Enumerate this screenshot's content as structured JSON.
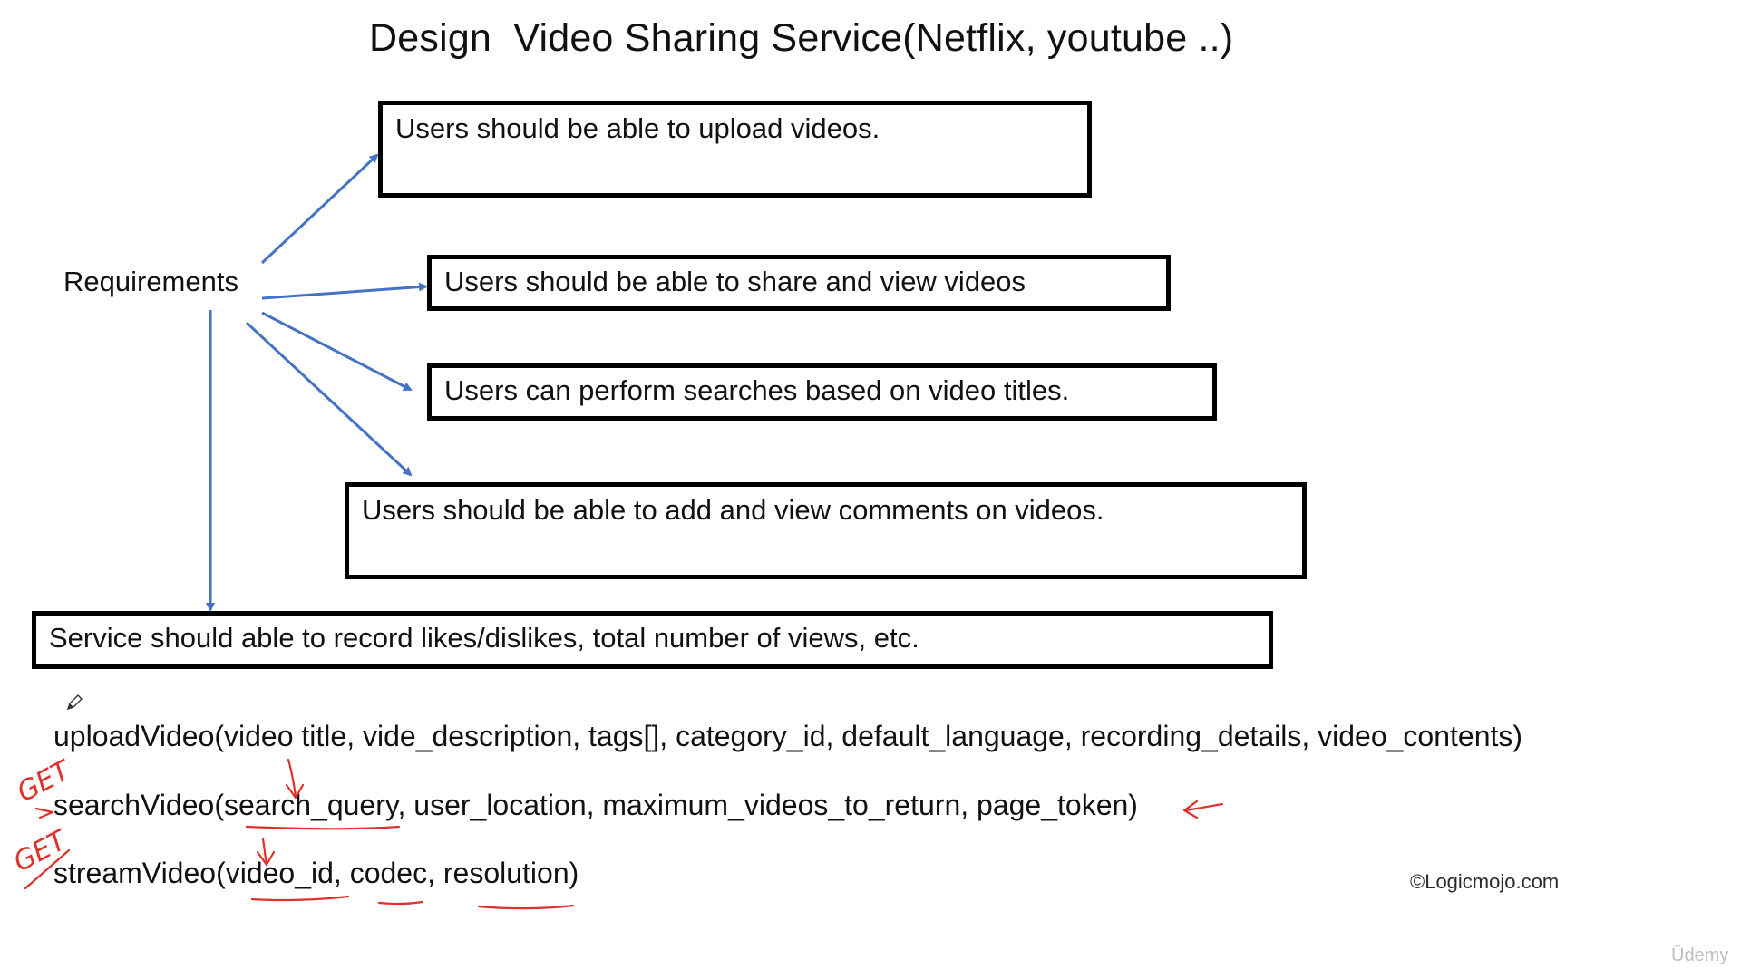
{
  "title": "Design  Video Sharing Service(Netflix, youtube ..)",
  "requirements_label": "Requirements",
  "requirements": [
    "Users should be able to upload videos.",
    "Users should be able to share and view videos",
    "Users can perform searches based on video titles.",
    "Users should be able to add and view comments on videos.",
    "Service should able to record likes/dislikes, total number of views, etc."
  ],
  "apis": [
    "uploadVideo(video title, vide_description, tags[], category_id, default_language, recording_details, video_contents)",
    "searchVideo(search_query, user_location, maximum_videos_to_return, page_token)",
    "streamVideo(video_id, codec, resolution)"
  ],
  "annotations": {
    "get_1": "GET",
    "get_2": "GET"
  },
  "copyright": "©Logicmojo.com",
  "watermark": "Ûdemy",
  "colors": {
    "arrow": "#4472c4",
    "annotation": "#e0302c",
    "box_border": "#000000"
  },
  "icons": {
    "cursor": "pencil-icon"
  }
}
